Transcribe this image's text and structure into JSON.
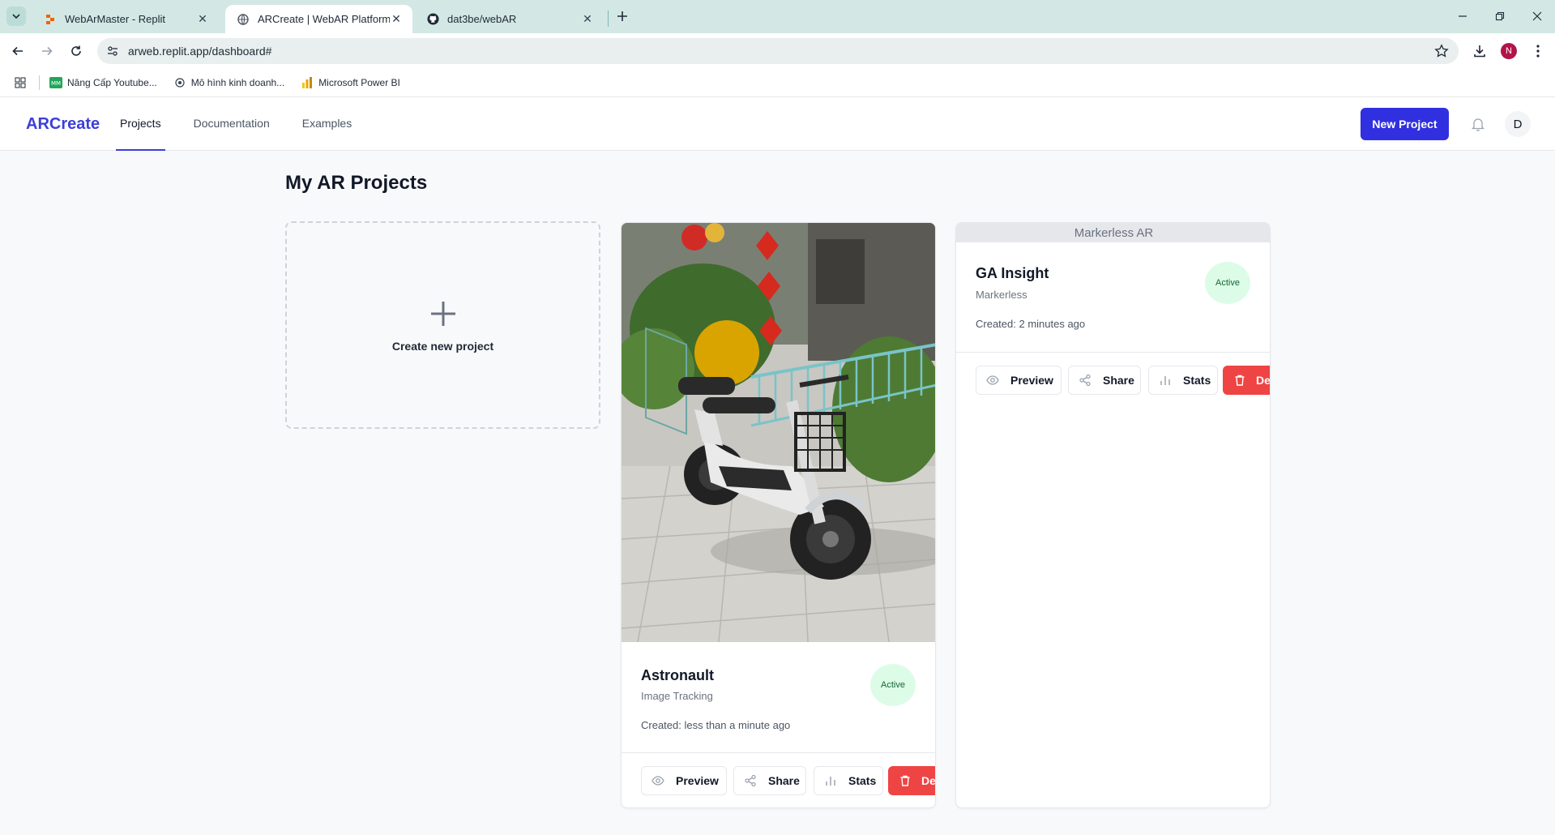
{
  "browser": {
    "tabs": [
      {
        "label": "WebArMaster - Replit",
        "active": false,
        "icon": "replit-icon"
      },
      {
        "label": "ARCreate | WebAR Platform",
        "active": true,
        "icon": "globe-icon"
      },
      {
        "label": "dat3be/webAR",
        "active": false,
        "icon": "github-icon"
      }
    ],
    "url": "arweb.replit.app/dashboard#",
    "profile_initial": "N",
    "bookmarks": [
      {
        "label": "Nâng Cấp Youtube..."
      },
      {
        "label": "Mô hình kinh doanh..."
      },
      {
        "label": "Microsoft Power BI"
      }
    ]
  },
  "app": {
    "brand": "ARCreate",
    "nav": [
      {
        "label": "Projects",
        "active": true
      },
      {
        "label": "Documentation",
        "active": false
      },
      {
        "label": "Examples",
        "active": false
      }
    ],
    "new_project_label": "New Project",
    "avatar_initial": "D"
  },
  "main": {
    "title": "My AR Projects",
    "create_card_label": "Create new project",
    "projects": [
      {
        "title": "Astronault",
        "type": "Image Tracking",
        "created": "Created: less than a minute ago",
        "status": "Active",
        "has_image": true,
        "actions": [
          "Preview",
          "Share",
          "Stats",
          "Del"
        ]
      },
      {
        "title": "GA Insight",
        "type": "Markerless",
        "created": "Created: 2 minutes ago",
        "status": "Active",
        "header_strip": "Markerless AR",
        "actions": [
          "Preview",
          "Share",
          "Stats",
          "Del"
        ]
      }
    ]
  },
  "colors": {
    "accent": "#3030e0",
    "brand": "#3b3fd8",
    "danger": "#ef4444",
    "active_badge_bg": "#dcfce7",
    "active_badge_text": "#166534"
  }
}
